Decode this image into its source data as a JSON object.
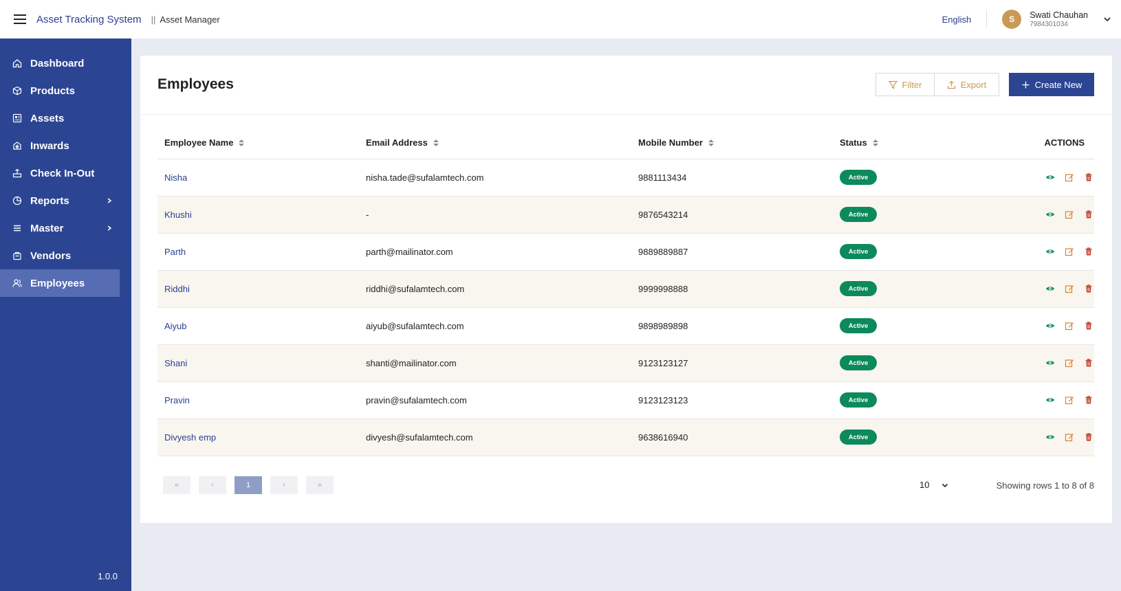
{
  "header": {
    "app_title": "Asset Tracking System",
    "separator": "||",
    "subtitle": "Asset Manager",
    "language": "English",
    "user": {
      "initial": "S",
      "name": "Swati Chauhan",
      "phone": "7984301034"
    }
  },
  "sidebar": {
    "items": [
      {
        "label": "Dashboard",
        "icon": "home-icon"
      },
      {
        "label": "Products",
        "icon": "box-icon"
      },
      {
        "label": "Assets",
        "icon": "assets-icon"
      },
      {
        "label": "Inwards",
        "icon": "inwards-icon"
      },
      {
        "label": "Check In-Out",
        "icon": "checkinout-icon"
      },
      {
        "label": "Reports",
        "icon": "pie-chart-icon",
        "has_submenu": true
      },
      {
        "label": "Master",
        "icon": "list-icon",
        "has_submenu": true
      },
      {
        "label": "Vendors",
        "icon": "vendor-icon"
      },
      {
        "label": "Employees",
        "icon": "users-icon",
        "active": true
      }
    ],
    "version": "1.0.0"
  },
  "main": {
    "title": "Employees",
    "buttons": {
      "filter": "Filter",
      "export": "Export",
      "create": "Create New"
    },
    "table": {
      "columns": [
        "Employee Name",
        "Email Address",
        "Mobile Number",
        "Status",
        "ACTIONS"
      ],
      "rows": [
        {
          "name": "Nisha",
          "email": "nisha.tade@sufalamtech.com",
          "mobile": "9881113434",
          "status": "Active"
        },
        {
          "name": "Khushi",
          "email": "-",
          "mobile": "9876543214",
          "status": "Active"
        },
        {
          "name": "Parth",
          "email": "parth@mailinator.com",
          "mobile": "9889889887",
          "status": "Active"
        },
        {
          "name": "Riddhi",
          "email": "riddhi@sufalamtech.com",
          "mobile": "9999998888",
          "status": "Active"
        },
        {
          "name": "Aiyub",
          "email": "aiyub@sufalamtech.com",
          "mobile": "9898989898",
          "status": "Active"
        },
        {
          "name": "Shani",
          "email": "shanti@mailinator.com",
          "mobile": "9123123127",
          "status": "Active"
        },
        {
          "name": "Pravin",
          "email": "pravin@sufalamtech.com",
          "mobile": "9123123123",
          "status": "Active"
        },
        {
          "name": "Divyesh emp",
          "email": "divyesh@sufalamtech.com",
          "mobile": "9638616940",
          "status": "Active"
        }
      ]
    },
    "pagination": {
      "first": "«",
      "prev": "‹",
      "current": "1",
      "next": "›",
      "last": "»",
      "rows_per_page": "10",
      "showing": "Showing rows 1 to 8 of 8"
    }
  },
  "colors": {
    "sidebar_bg": "#2c4593",
    "sidebar_active": "#566db3",
    "accent_gold": "#c99a55",
    "status_active": "#0d8a5b",
    "view_icon": "#0d8a5b",
    "edit_icon": "#d9822b",
    "delete_icon": "#c0392b"
  }
}
